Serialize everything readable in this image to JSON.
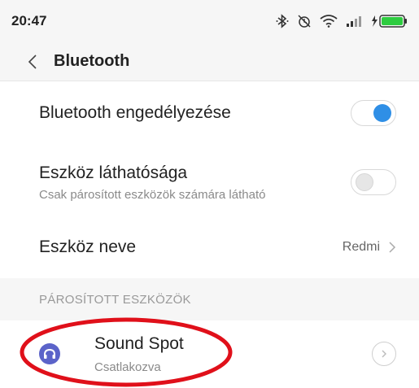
{
  "status_bar": {
    "time": "20:47",
    "icons": [
      "bluetooth-icon",
      "alarm-off-icon",
      "wifi-icon",
      "signal-icon",
      "battery-charging-icon"
    ],
    "battery_color": "#2ecc40"
  },
  "header": {
    "back_icon": "chevron-left-icon",
    "title": "Bluetooth"
  },
  "settings": {
    "enable_bluetooth": {
      "label": "Bluetooth engedélyezése",
      "toggle_on": true
    },
    "visibility": {
      "label": "Eszköz láthatósága",
      "sublabel": "Csak párosított eszközök számára látható",
      "toggle_on": false
    },
    "device_name": {
      "label": "Eszköz neve",
      "value": "Redmi"
    }
  },
  "paired_section": {
    "header": "PÁROSÍTOTT ESZKÖZÖK",
    "devices": [
      {
        "name": "Sound Spot",
        "status": "Csatlakozva",
        "icon": "headphones-icon",
        "icon_color": "#5b63c9"
      }
    ]
  },
  "colors": {
    "accent": "#2f8fe6",
    "annotation": "#e0101a"
  }
}
